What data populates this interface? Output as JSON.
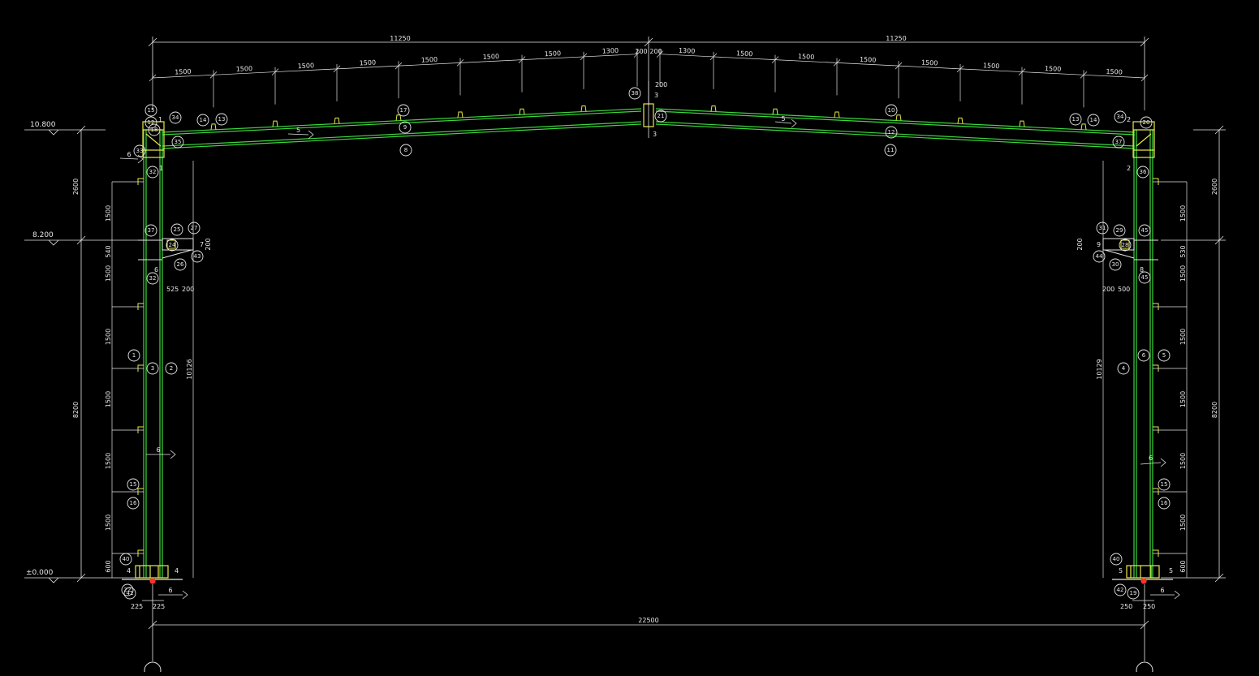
{
  "colors": {
    "background": "#000000",
    "member": "#3cd63c",
    "dimension": "#e6e6e6",
    "plate": "#e8e84a",
    "base_mark": "#ff3030"
  },
  "overall": {
    "half_span_left": "11250",
    "half_span_right": "11250",
    "span": "22500"
  },
  "rafter_spacing": {
    "left": [
      "1500",
      "1500",
      "1500",
      "1500",
      "1500",
      "1500",
      "1500",
      "1300"
    ],
    "ridge_left": "200",
    "ridge_right": "200",
    "ridge_vertical": "200",
    "right": [
      "1300",
      "1500",
      "1500",
      "1500",
      "1500",
      "1500",
      "1500",
      "1500"
    ]
  },
  "levels": {
    "eave": "10.800",
    "crane": "8.200",
    "ground": "±0.000"
  },
  "left_outer_dims": {
    "top": "2600",
    "bottom": "8200"
  },
  "right_outer_dims": {
    "top": "2600",
    "bottom": "8200"
  },
  "left_column_spacing": [
    "1500",
    "540",
    "1500",
    "1500",
    "1500",
    "1500",
    "1500",
    "600"
  ],
  "right_column_spacing": [
    "1500",
    "530",
    "1500",
    "1500",
    "1500",
    "1500",
    "1500",
    "600"
  ],
  "left_column_height": "10126",
  "right_column_height": "10129",
  "left_bracket_dims": [
    "525",
    "200",
    "200"
  ],
  "right_bracket_dims": [
    "200",
    "500",
    "200"
  ],
  "base_left_dims": [
    "225",
    "225"
  ],
  "base_right_dims": [
    "250",
    "250"
  ],
  "weld_labels": [
    "5",
    "5",
    "6",
    "6",
    "6",
    "6",
    "6"
  ],
  "section_marks": [
    "1",
    "1",
    "2",
    "2",
    "3",
    "3",
    "4",
    "4",
    "5",
    "5",
    "6",
    "7",
    "8",
    "9"
  ],
  "callouts_left": [
    "34",
    "14",
    "13",
    "12",
    "33",
    "35",
    "32",
    "15",
    "37",
    "25",
    "27",
    "24",
    "26",
    "43",
    "32",
    "1",
    "3",
    "2",
    "15",
    "16",
    "40",
    "22",
    "41",
    "17",
    "9",
    "8",
    "18"
  ],
  "callouts_right": [
    "10",
    "12",
    "11",
    "38",
    "21",
    "13",
    "14",
    "34",
    "20",
    "37",
    "36",
    "31",
    "29",
    "45",
    "28",
    "44",
    "30",
    "45",
    "6",
    "5",
    "4",
    "15",
    "16",
    "40",
    "42",
    "19"
  ]
}
